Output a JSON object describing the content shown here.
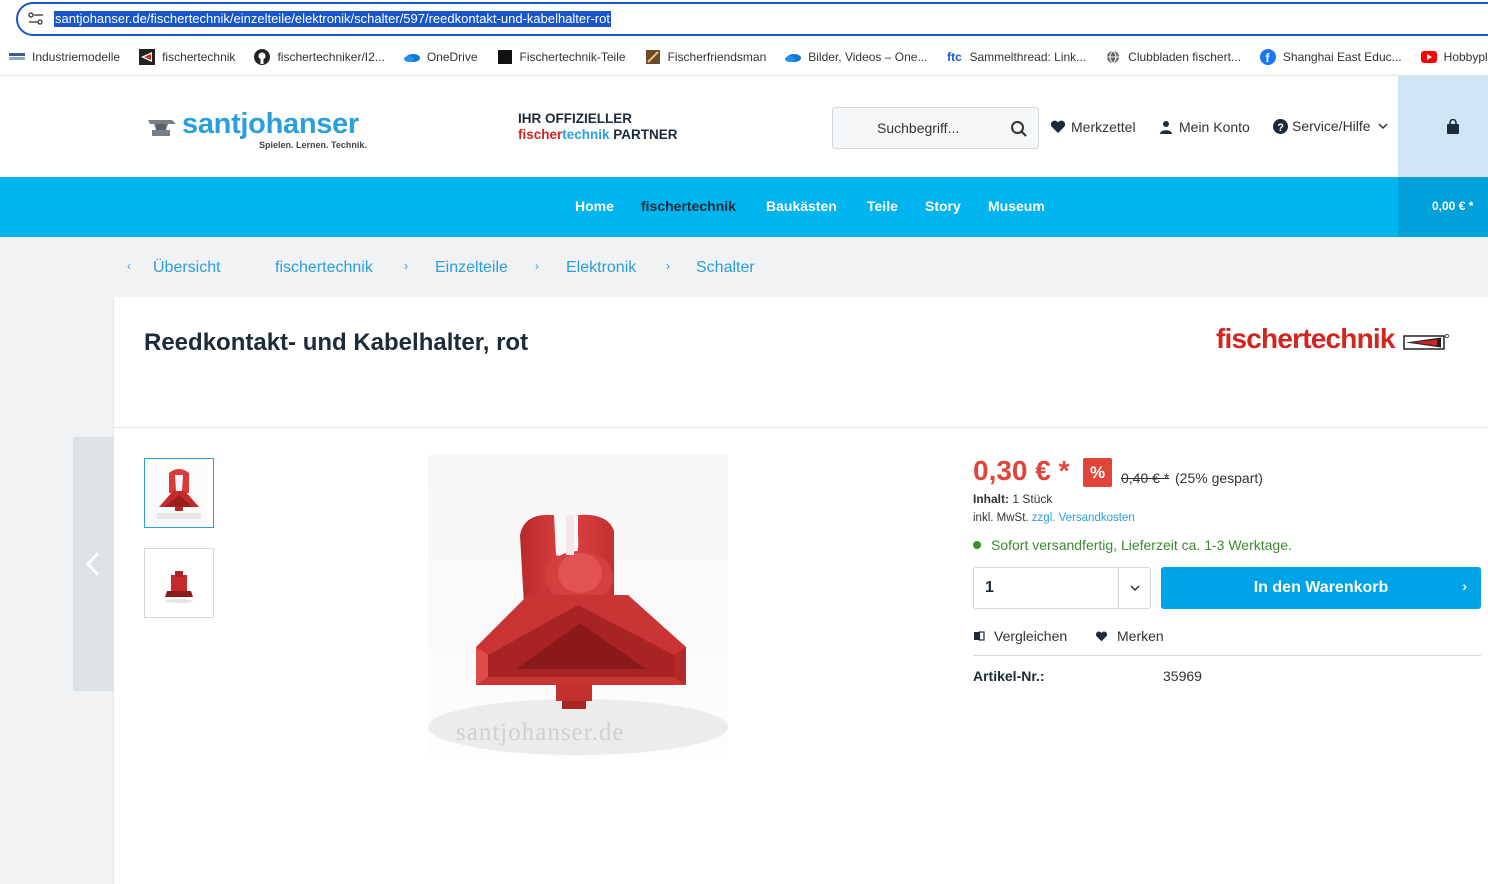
{
  "browser": {
    "url": "santjohanser.de/fischertechnik/einzelteile/elektronik/schalter/597/reedkontakt-und-kabelhalter-rot",
    "bookmarks": [
      {
        "label": "Industriemodelle",
        "icon": "bookmark-bar-icon"
      },
      {
        "label": "fischertechnik",
        "icon": "fischertechnik-icon"
      },
      {
        "label": "fischertechniker/I2...",
        "icon": "github-icon"
      },
      {
        "label": "OneDrive",
        "icon": "onedrive-icon"
      },
      {
        "label": "Fischertechnik-Teile",
        "icon": "black-square-icon"
      },
      {
        "label": "Fischerfriendsman",
        "icon": "ffm-icon"
      },
      {
        "label": "Bilder, Videos – One...",
        "icon": "onedrive-icon"
      },
      {
        "label": "Sammelthread: Link...",
        "icon": "ftc-icon"
      },
      {
        "label": "Clubbladen fischert...",
        "icon": "globe-icon"
      },
      {
        "label": "Shanghai East Educ...",
        "icon": "facebook-icon"
      },
      {
        "label": "Hobbyplott",
        "icon": "youtube-icon"
      }
    ]
  },
  "header": {
    "logo_name": "santjohanser",
    "logo_tagline": "Spielen. Lernen. Technik.",
    "partner_line1": "IHR OFFIZIELLER",
    "partner_ft_part1": "fischer",
    "partner_ft_part2": "technik",
    "partner_word": " PARTNER",
    "search_placeholder": "Suchbegriff...",
    "wishlist_label": "Merkzettel",
    "account_label": "Mein Konto",
    "service_label": "Service/Hilfe"
  },
  "nav": {
    "items": [
      "Home",
      "fischertechnik",
      "Baukästen",
      "Teile",
      "Story",
      "Museum"
    ],
    "cart_amount": "0,00 € *"
  },
  "breadcrumb": {
    "back_label": "Übersicht",
    "items": [
      "fischertechnik",
      "Einzelteile",
      "Elektronik",
      "Schalter"
    ]
  },
  "product": {
    "title": "Reedkontakt- und Kabelhalter, rot",
    "brand": "fischertechnik",
    "watermark": "santjohanser.de",
    "price": "0,30 € *",
    "discount_badge": "%",
    "old_price": "0,40 € *",
    "saved": "(25% gespart)",
    "content_label": "Inhalt:",
    "content_value": "1 Stück",
    "tax_text": "inkl. MwSt.",
    "shipping_link": "zzgl. Versandkosten",
    "delivery": "Sofort versandfertig, Lieferzeit ca. 1-3 Werktage.",
    "quantity": "1",
    "add_to_cart": "In den Warenkorb",
    "compare": "Vergleichen",
    "remember": "Merken",
    "sku_label": "Artikel-Nr.:",
    "sku_value": "35969"
  },
  "colors": {
    "brand_blue": "#00b4f0",
    "price_red": "#e1453a",
    "link_blue": "#2a9fdb",
    "delivery_green": "#3a8c2f"
  }
}
